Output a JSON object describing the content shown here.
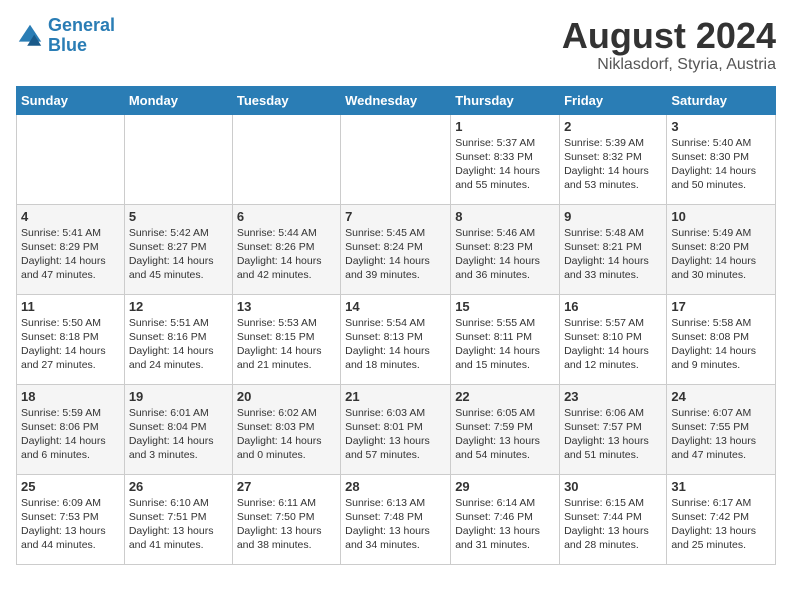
{
  "header": {
    "logo_line1": "General",
    "logo_line2": "Blue",
    "month_year": "August 2024",
    "location": "Niklasdorf, Styria, Austria"
  },
  "days_of_week": [
    "Sunday",
    "Monday",
    "Tuesday",
    "Wednesday",
    "Thursday",
    "Friday",
    "Saturday"
  ],
  "weeks": [
    [
      {
        "num": "",
        "info": ""
      },
      {
        "num": "",
        "info": ""
      },
      {
        "num": "",
        "info": ""
      },
      {
        "num": "",
        "info": ""
      },
      {
        "num": "1",
        "info": "Sunrise: 5:37 AM\nSunset: 8:33 PM\nDaylight: 14 hours and 55 minutes."
      },
      {
        "num": "2",
        "info": "Sunrise: 5:39 AM\nSunset: 8:32 PM\nDaylight: 14 hours and 53 minutes."
      },
      {
        "num": "3",
        "info": "Sunrise: 5:40 AM\nSunset: 8:30 PM\nDaylight: 14 hours and 50 minutes."
      }
    ],
    [
      {
        "num": "4",
        "info": "Sunrise: 5:41 AM\nSunset: 8:29 PM\nDaylight: 14 hours and 47 minutes."
      },
      {
        "num": "5",
        "info": "Sunrise: 5:42 AM\nSunset: 8:27 PM\nDaylight: 14 hours and 45 minutes."
      },
      {
        "num": "6",
        "info": "Sunrise: 5:44 AM\nSunset: 8:26 PM\nDaylight: 14 hours and 42 minutes."
      },
      {
        "num": "7",
        "info": "Sunrise: 5:45 AM\nSunset: 8:24 PM\nDaylight: 14 hours and 39 minutes."
      },
      {
        "num": "8",
        "info": "Sunrise: 5:46 AM\nSunset: 8:23 PM\nDaylight: 14 hours and 36 minutes."
      },
      {
        "num": "9",
        "info": "Sunrise: 5:48 AM\nSunset: 8:21 PM\nDaylight: 14 hours and 33 minutes."
      },
      {
        "num": "10",
        "info": "Sunrise: 5:49 AM\nSunset: 8:20 PM\nDaylight: 14 hours and 30 minutes."
      }
    ],
    [
      {
        "num": "11",
        "info": "Sunrise: 5:50 AM\nSunset: 8:18 PM\nDaylight: 14 hours and 27 minutes."
      },
      {
        "num": "12",
        "info": "Sunrise: 5:51 AM\nSunset: 8:16 PM\nDaylight: 14 hours and 24 minutes."
      },
      {
        "num": "13",
        "info": "Sunrise: 5:53 AM\nSunset: 8:15 PM\nDaylight: 14 hours and 21 minutes."
      },
      {
        "num": "14",
        "info": "Sunrise: 5:54 AM\nSunset: 8:13 PM\nDaylight: 14 hours and 18 minutes."
      },
      {
        "num": "15",
        "info": "Sunrise: 5:55 AM\nSunset: 8:11 PM\nDaylight: 14 hours and 15 minutes."
      },
      {
        "num": "16",
        "info": "Sunrise: 5:57 AM\nSunset: 8:10 PM\nDaylight: 14 hours and 12 minutes."
      },
      {
        "num": "17",
        "info": "Sunrise: 5:58 AM\nSunset: 8:08 PM\nDaylight: 14 hours and 9 minutes."
      }
    ],
    [
      {
        "num": "18",
        "info": "Sunrise: 5:59 AM\nSunset: 8:06 PM\nDaylight: 14 hours and 6 minutes."
      },
      {
        "num": "19",
        "info": "Sunrise: 6:01 AM\nSunset: 8:04 PM\nDaylight: 14 hours and 3 minutes."
      },
      {
        "num": "20",
        "info": "Sunrise: 6:02 AM\nSunset: 8:03 PM\nDaylight: 14 hours and 0 minutes."
      },
      {
        "num": "21",
        "info": "Sunrise: 6:03 AM\nSunset: 8:01 PM\nDaylight: 13 hours and 57 minutes."
      },
      {
        "num": "22",
        "info": "Sunrise: 6:05 AM\nSunset: 7:59 PM\nDaylight: 13 hours and 54 minutes."
      },
      {
        "num": "23",
        "info": "Sunrise: 6:06 AM\nSunset: 7:57 PM\nDaylight: 13 hours and 51 minutes."
      },
      {
        "num": "24",
        "info": "Sunrise: 6:07 AM\nSunset: 7:55 PM\nDaylight: 13 hours and 47 minutes."
      }
    ],
    [
      {
        "num": "25",
        "info": "Sunrise: 6:09 AM\nSunset: 7:53 PM\nDaylight: 13 hours and 44 minutes."
      },
      {
        "num": "26",
        "info": "Sunrise: 6:10 AM\nSunset: 7:51 PM\nDaylight: 13 hours and 41 minutes."
      },
      {
        "num": "27",
        "info": "Sunrise: 6:11 AM\nSunset: 7:50 PM\nDaylight: 13 hours and 38 minutes."
      },
      {
        "num": "28",
        "info": "Sunrise: 6:13 AM\nSunset: 7:48 PM\nDaylight: 13 hours and 34 minutes."
      },
      {
        "num": "29",
        "info": "Sunrise: 6:14 AM\nSunset: 7:46 PM\nDaylight: 13 hours and 31 minutes."
      },
      {
        "num": "30",
        "info": "Sunrise: 6:15 AM\nSunset: 7:44 PM\nDaylight: 13 hours and 28 minutes."
      },
      {
        "num": "31",
        "info": "Sunrise: 6:17 AM\nSunset: 7:42 PM\nDaylight: 13 hours and 25 minutes."
      }
    ]
  ]
}
